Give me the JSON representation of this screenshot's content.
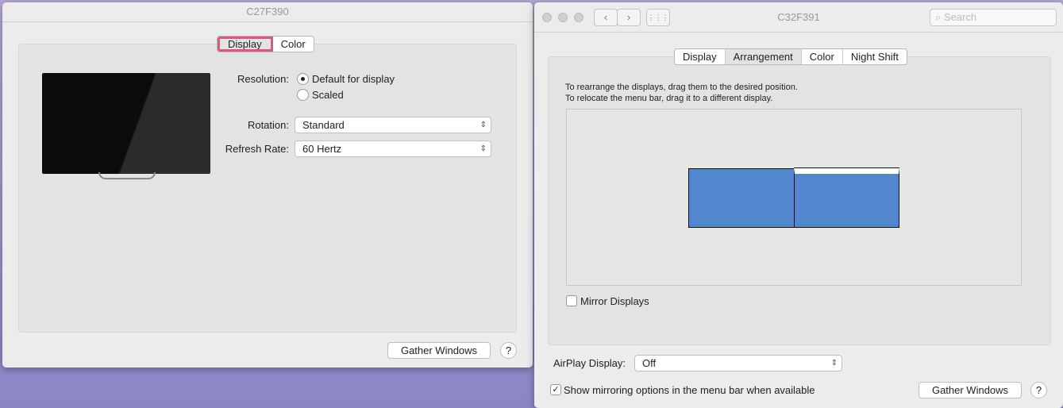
{
  "window1": {
    "title": "C27F390",
    "tabs": [
      "Display",
      "Color"
    ],
    "resolution_label": "Resolution:",
    "resolution_options": [
      "Default for display",
      "Scaled"
    ],
    "rotation_label": "Rotation:",
    "rotation_value": "Standard",
    "refresh_label": "Refresh Rate:",
    "refresh_value": "60 Hertz",
    "gather": "Gather Windows",
    "help": "?"
  },
  "window2": {
    "title": "C32F391",
    "search_placeholder": "Search",
    "tabs": [
      "Display",
      "Arrangement",
      "Color",
      "Night Shift"
    ],
    "instr1": "To rearrange the displays, drag them to the desired position.",
    "instr2": "To relocate the menu bar, drag it to a different display.",
    "mirror": "Mirror Displays",
    "airplay_label": "AirPlay Display:",
    "airplay_value": "Off",
    "show_mirroring": "Show mirroring options in the menu bar when available",
    "gather": "Gather Windows",
    "help": "?",
    "display_color": "#5287cf"
  }
}
